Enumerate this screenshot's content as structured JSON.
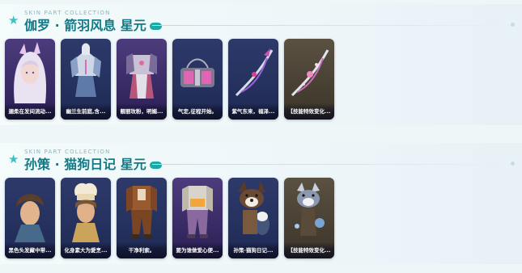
{
  "sections": [
    {
      "subtitle": "SKIN PART COLLECTION",
      "title": "伽罗 · 箭羽风息 星元",
      "cards": [
        {
          "label": "逦柔在发间流动...",
          "icon": "hair-portrait"
        },
        {
          "label": "幽兰生前庭,含...",
          "icon": "armor-top"
        },
        {
          "label": "靓丽玫粉，明媚...",
          "icon": "armor-outfit"
        },
        {
          "label": "气定,征程开始。",
          "icon": "quiver-bag"
        },
        {
          "label": "紫气东来，福泽...",
          "icon": "bow-weapon"
        },
        {
          "label": "【技能特效变化...",
          "icon": "bow-effect"
        }
      ]
    },
    {
      "subtitle": "SKIN PART COLLECTION",
      "title": "孙策 · 猫狗日记 星元",
      "cards": [
        {
          "label": "黑色头发藏中带...",
          "icon": "hair-portrait"
        },
        {
          "label": "化身素大为愛烹...",
          "icon": "chef-hat"
        },
        {
          "label": "干净利索。",
          "icon": "brown-outfit"
        },
        {
          "label": "要为谁做爱心便...",
          "icon": "hoodie-outfit"
        },
        {
          "label": "孙策·猫狗日记...",
          "icon": "dog-companion"
        },
        {
          "label": "【技能特效变化...",
          "icon": "dog-effect"
        }
      ]
    }
  ]
}
